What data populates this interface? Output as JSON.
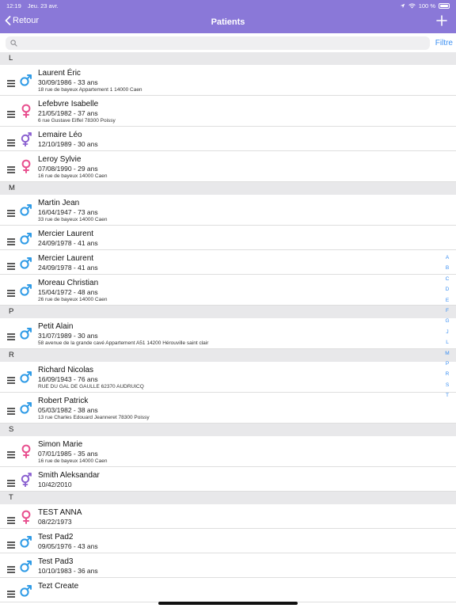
{
  "status_bar": {
    "time": "12:19",
    "date": "Jeu. 23 avr.",
    "battery": "100 %"
  },
  "nav": {
    "back_label": "Retour",
    "title": "Patients"
  },
  "search": {
    "placeholder": "",
    "filter_label": "Filtre"
  },
  "colors": {
    "header": "#8a78d8",
    "accent": "#3b8ff2",
    "male": "#2f9be6",
    "female": "#e8508f",
    "other": "#8a60d0"
  },
  "sections": [
    {
      "letter": "L",
      "patients": [
        {
          "name": "Laurent Éric",
          "dob": "30/09/1986 - 33 ans",
          "address": "18 rue de bayeux Appartement 1 14000 Caen",
          "gender": "male-icon"
        },
        {
          "name": "Lefebvre Isabelle",
          "dob": "21/05/1982 - 37 ans",
          "address": "6 rue Gustave Eiffel 78300 Poissy",
          "gender": "female-icon"
        },
        {
          "name": "Lemaire Léo",
          "dob": "12/10/1989 - 30 ans",
          "address": "",
          "gender": "other-gender-icon"
        },
        {
          "name": "Leroy Sylvie",
          "dob": "07/08/1990 - 29 ans",
          "address": "16 rue de bayeux 14000 Caen",
          "gender": "female-icon"
        }
      ]
    },
    {
      "letter": "M",
      "patients": [
        {
          "name": "Martin Jean",
          "dob": "16/04/1947 - 73 ans",
          "address": "33 rue de bayeux 14000 Caen",
          "gender": "male-icon"
        },
        {
          "name": "Mercier Laurent",
          "dob": "24/09/1978 - 41 ans",
          "address": "",
          "gender": "male-icon"
        },
        {
          "name": "Mercier Laurent",
          "dob": "24/09/1978 - 41 ans",
          "address": "",
          "gender": "male-icon"
        },
        {
          "name": "Moreau Christian",
          "dob": "15/04/1972 - 48 ans",
          "address": "26 rue de bayeux 14000 Caen",
          "gender": "male-icon"
        }
      ]
    },
    {
      "letter": "P",
      "patients": [
        {
          "name": "Petit Alain",
          "dob": "31/07/1989 - 30 ans",
          "address": "58 avenue de la grande cavé Appartement A51 14200 Hérouville saint clair",
          "gender": "male-icon"
        }
      ]
    },
    {
      "letter": "R",
      "patients": [
        {
          "name": "Richard Nicolas",
          "dob": "16/09/1943 - 76 ans",
          "address": "RUE DU GAL DE GAULLE 62370 AUDRUICQ",
          "gender": "male-icon"
        },
        {
          "name": "Robert Patrick",
          "dob": "05/03/1982 - 38 ans",
          "address": "13 rue Charles Edouard Jeanneret 78300 Poissy",
          "gender": "male-icon"
        }
      ]
    },
    {
      "letter": "S",
      "patients": [
        {
          "name": "Simon Marie",
          "dob": "07/01/1985 - 35 ans",
          "address": "16 rue de bayeux 14000 Caen",
          "gender": "female-icon"
        },
        {
          "name": "Smith Aleksandar",
          "dob": "10/42/2010",
          "address": "",
          "gender": "other-gender-icon"
        }
      ]
    },
    {
      "letter": "T",
      "patients": [
        {
          "name": "TEST ANNA",
          "dob": "08/22/1973",
          "address": "",
          "gender": "female-icon"
        },
        {
          "name": "Test Pad2",
          "dob": "09/05/1976 - 43 ans",
          "address": "",
          "gender": "male-icon"
        },
        {
          "name": "Test Pad3",
          "dob": "10/10/1983 - 36 ans",
          "address": "",
          "gender": "male-icon"
        },
        {
          "name": "Tezt Create",
          "dob": "",
          "address": "",
          "gender": "male-icon"
        }
      ]
    }
  ],
  "index_letters": [
    "A",
    "B",
    "C",
    "D",
    "E",
    "F",
    "G",
    "J",
    "L",
    "M",
    "P",
    "R",
    "S",
    "T"
  ]
}
